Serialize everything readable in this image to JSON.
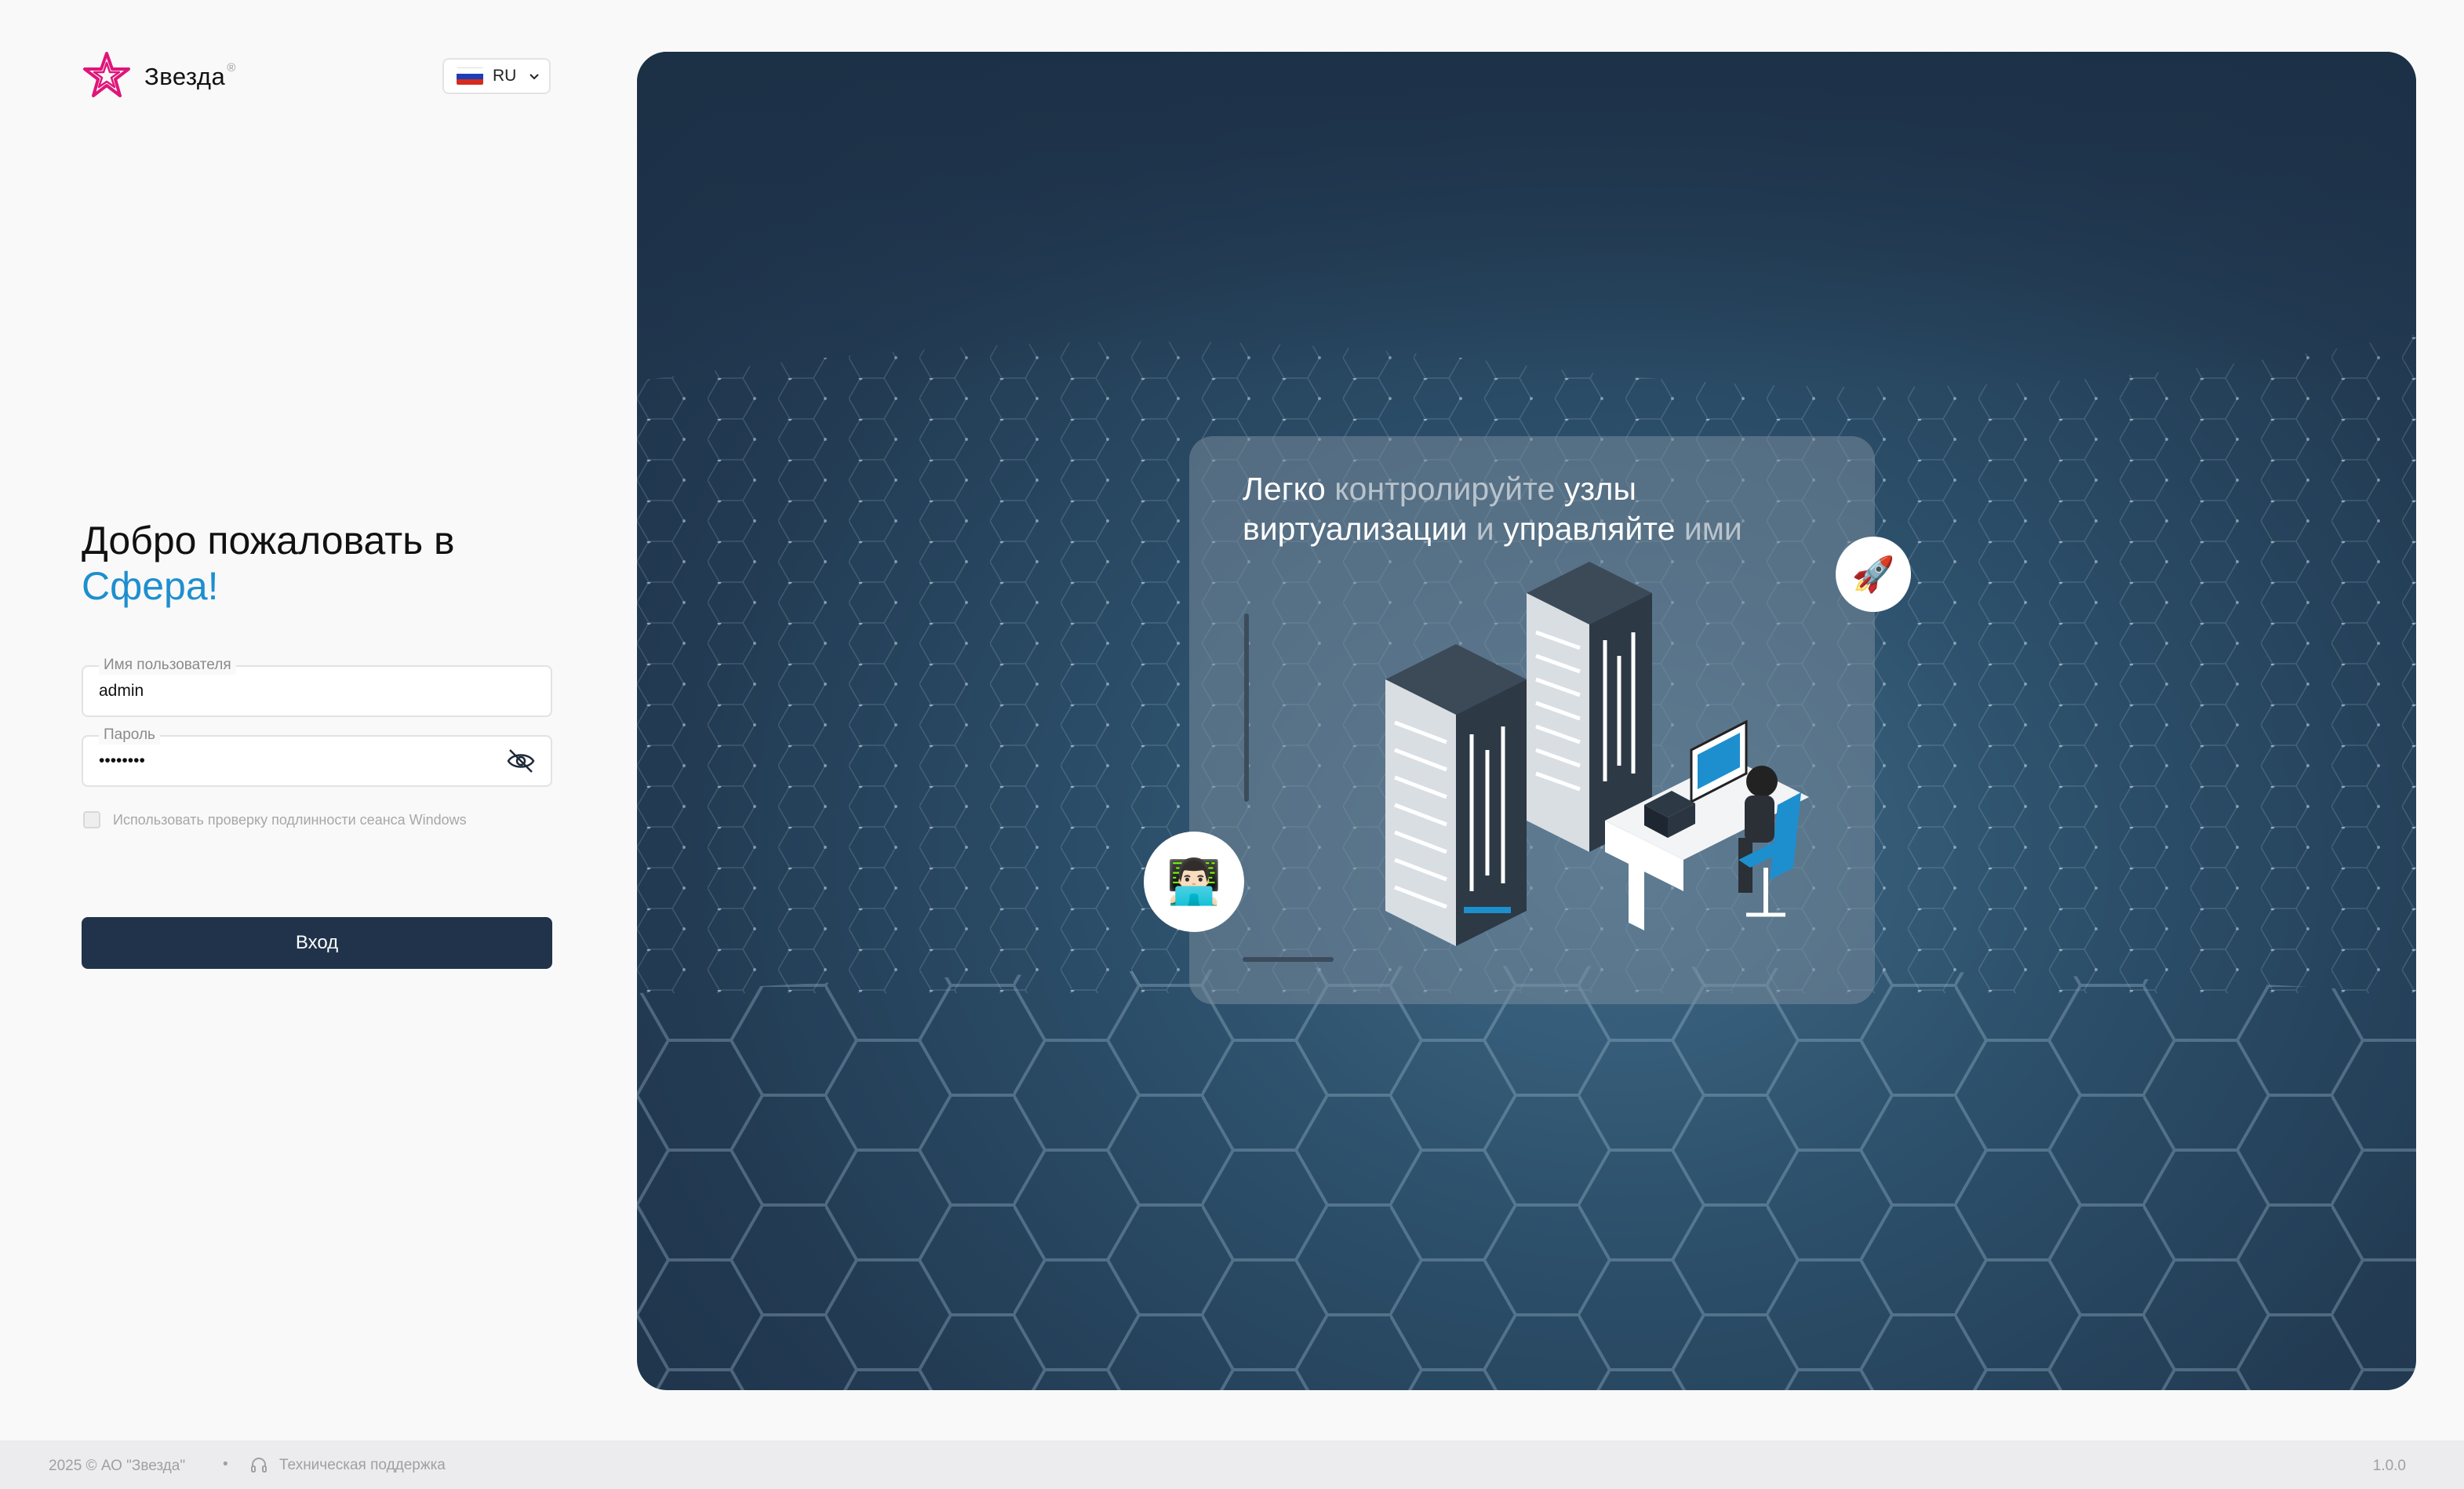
{
  "brand": {
    "name": "Звезда",
    "reg_mark": "®"
  },
  "language": {
    "code": "RU"
  },
  "welcome": {
    "line1": "Добро пожаловать в",
    "product": "Сфера!"
  },
  "form": {
    "username_label": "Имя пользователя",
    "username_value": "admin",
    "password_label": "Пароль",
    "password_value": "••••••••",
    "windows_auth_label": "Использовать проверку подлинности сеанса Windows",
    "submit_label": "Вход"
  },
  "hero": {
    "t1": "Легко",
    "t2": "контролируйте",
    "t3": "узлы виртуализации",
    "t4": "и",
    "t5": "управляйте",
    "t6": "ими",
    "rocket_emoji": "🚀",
    "person_emoji": "👨🏻‍💻"
  },
  "footer": {
    "copyright": "2025 © АО \"Звезда\"",
    "separator": "•",
    "support": "Техническая поддержка",
    "version": "1.0.0"
  },
  "colors": {
    "accent": "#1d8fcf",
    "button": "#20334a",
    "logo": "#e0157a"
  }
}
